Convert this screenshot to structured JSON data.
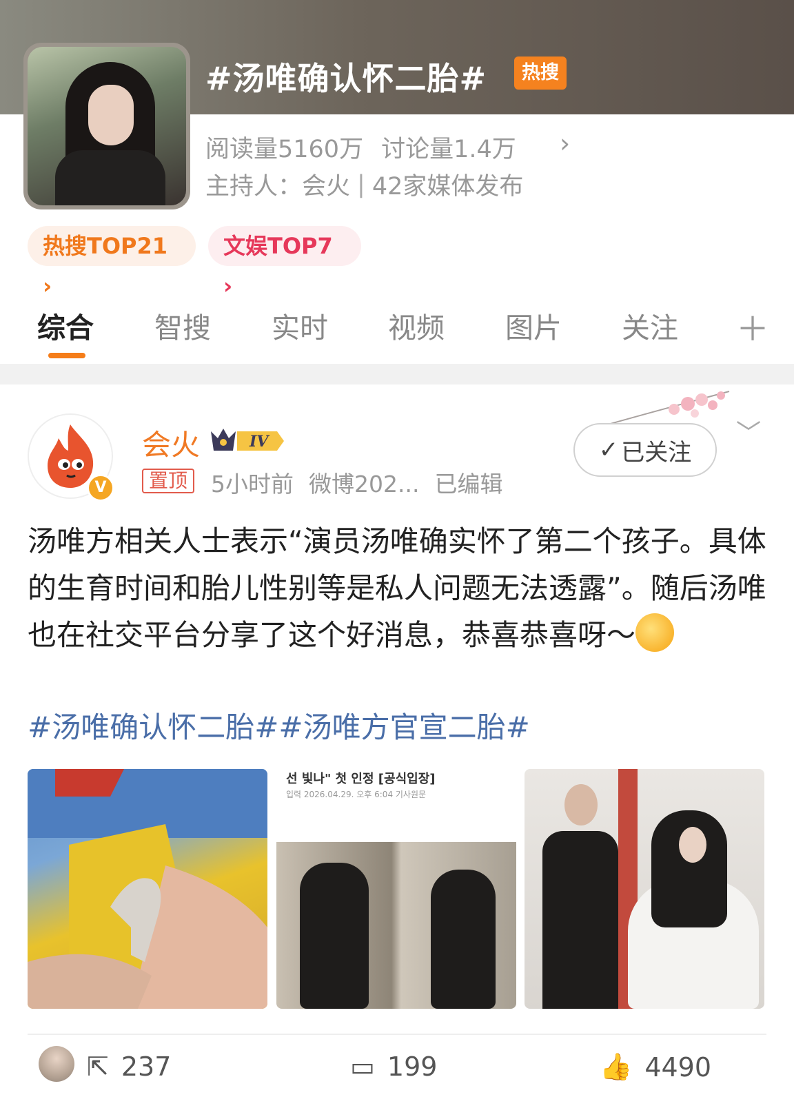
{
  "topic": {
    "title": "#汤唯确认怀二胎#",
    "hot_badge": "热搜",
    "reads": "阅读量5160万",
    "discussions": "讨论量1.4万",
    "host_label": "主持人：会火",
    "media": "42家媒体发布",
    "rank_hot": "热搜TOP21",
    "rank_ent": "文娱TOP7"
  },
  "tabs": [
    {
      "label": "综合"
    },
    {
      "label": "智搜"
    },
    {
      "label": "实时"
    },
    {
      "label": "视频"
    },
    {
      "label": "图片"
    },
    {
      "label": "关注"
    }
  ],
  "post": {
    "author": "会火",
    "level": "IV",
    "pinned": "置顶",
    "time": "5小时前",
    "source": "微博202...",
    "edited": "已编辑",
    "follow_label": "已关注",
    "text": "汤唯方相关人士表示“演员汤唯确实怀了第二个孩子。具体的生育时间和胎儿性别等是私人问题无法透露”。随后汤唯也在社交平台分享了这个好消息，恭喜恭喜呀～",
    "hashtags": "#汤唯确认怀二胎##汤唯方官宣二胎#",
    "image2_headline": "선 빛나\" 첫 인정 [공식입장]",
    "image2_meta": "입력 2026.04.29. 오후 6:04  기사원문"
  },
  "actions": {
    "repost_count": "237",
    "comment_count": "199",
    "like_count": "4490"
  },
  "colors": {
    "accent": "#f57d19",
    "hashtag": "#4a6ea8",
    "author": "#f07a25"
  }
}
